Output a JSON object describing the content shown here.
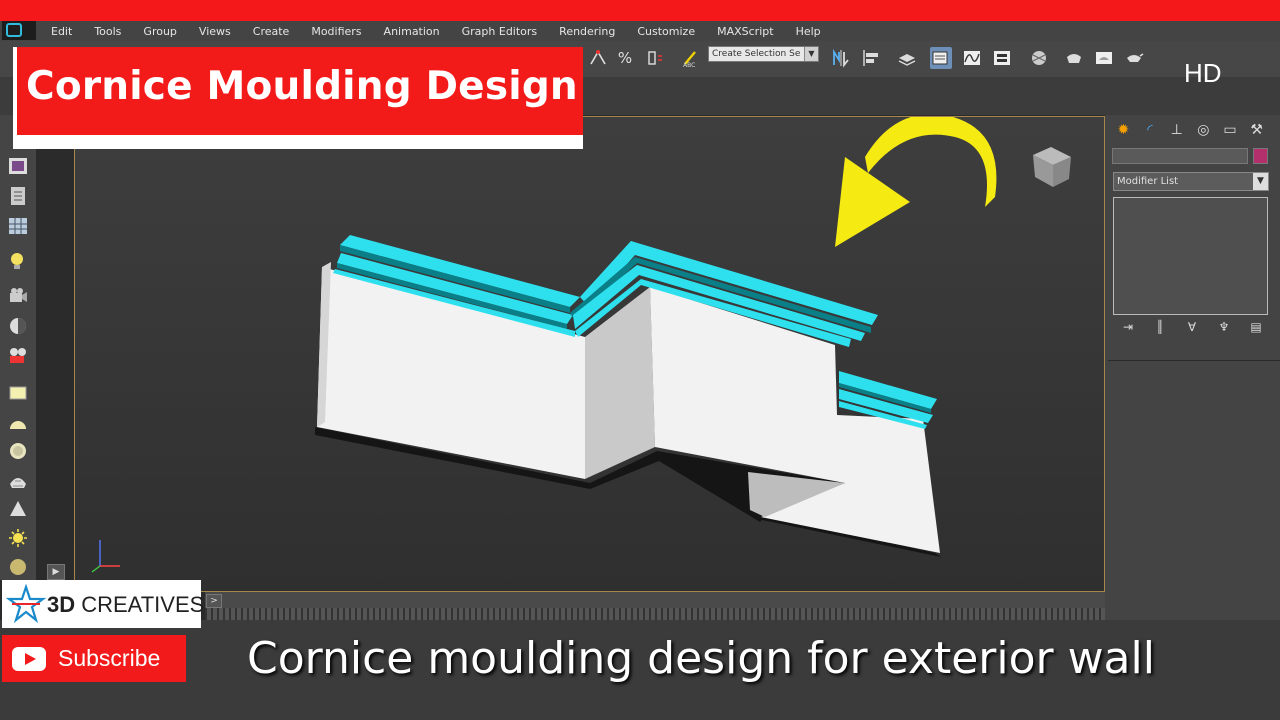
{
  "menu": {
    "items": [
      "Edit",
      "Tools",
      "Group",
      "Views",
      "Create",
      "Modifiers",
      "Animation",
      "Graph Editors",
      "Rendering",
      "Customize",
      "MAXScript",
      "Help"
    ]
  },
  "toolbar": {
    "selection_set_value": "Create Selection Se",
    "icons": [
      "snap-2d-icon",
      "angle-snap-icon",
      "percent-snap-icon",
      "spinner-snap-icon",
      "edit-named-selection-icon",
      "mirror-icon",
      "align-icon",
      "layer-manager-icon",
      "scene-explorer-icon",
      "curve-editor-icon",
      "schematic-view-icon",
      "material-editor-icon",
      "render-setup-icon",
      "render-frame-icon",
      "render-icon"
    ]
  },
  "overlay": {
    "title": "Cornice Moulding Design",
    "hd_label": "HD",
    "brand_bold": "3D",
    "brand_rest": " CREATIVES",
    "subscribe": "Subscribe",
    "caption": "Cornice moulding design for exterior wall"
  },
  "command_panel": {
    "modifier_list": "Modifier List",
    "tabs": [
      "create-icon",
      "modify-icon",
      "hierarchy-icon",
      "motion-icon",
      "display-icon",
      "utilities-icon"
    ]
  },
  "left_toolbar": {
    "icons": [
      "viewport-icon",
      "document-icon",
      "grid-icon",
      "light-bulb-icon",
      "camera-icon",
      "sphere-half-icon",
      "camera-film-icon",
      "box-icon",
      "dome-icon",
      "circle-icon",
      "geosphere-icon",
      "cone-icon",
      "sun-icon",
      "disk-icon"
    ]
  },
  "colors": {
    "brand_red": "#f31a1a",
    "moulding_cyan": "#2ee0ee",
    "arrow_yellow": "#f5ea12",
    "wall_white": "#f2f2f2",
    "viewport_bg": "#3a3a3a"
  }
}
